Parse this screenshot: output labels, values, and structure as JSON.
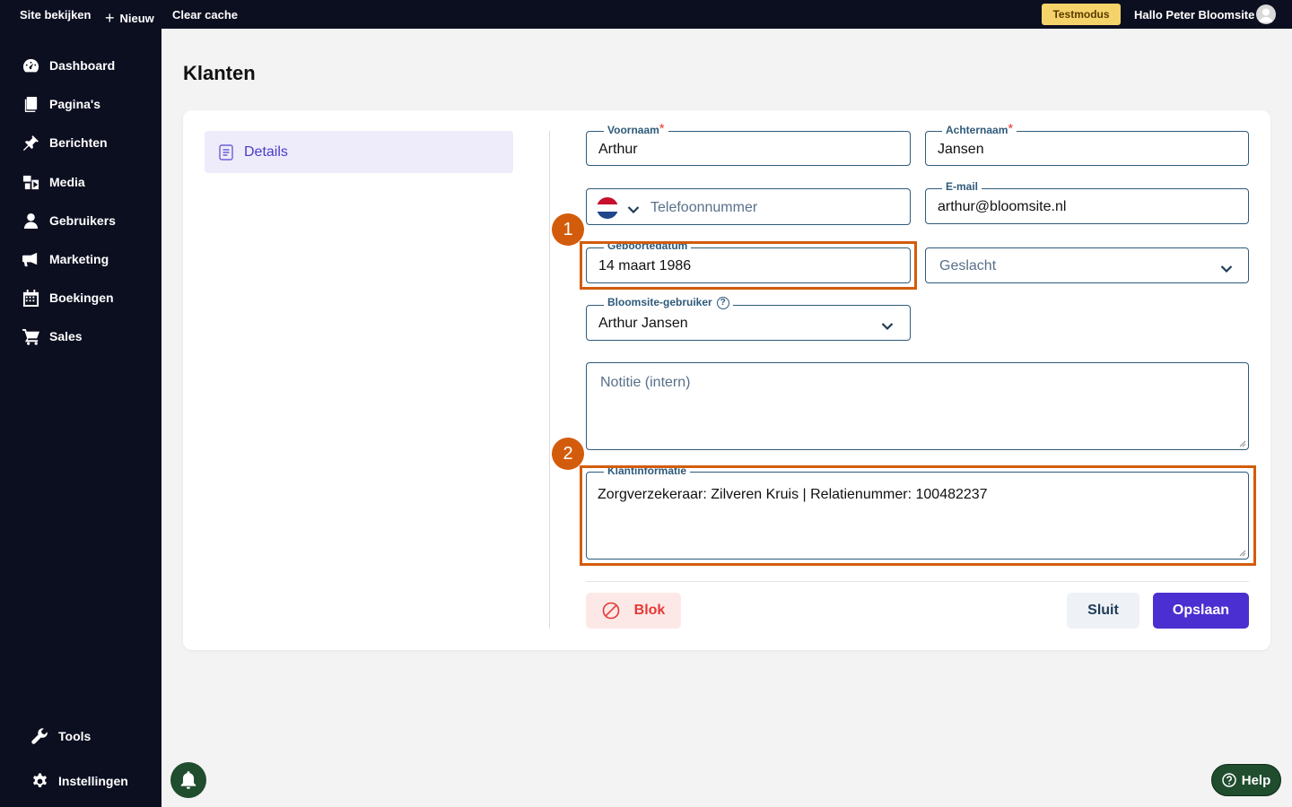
{
  "topbar": {
    "site_view": "Site bekijken",
    "new": "Nieuw",
    "clear_cache": "Clear cache",
    "test_mode": "Testmodus",
    "greeting": "Hallo Peter Bloomsite"
  },
  "sidebar": {
    "items": [
      {
        "label": "Dashboard",
        "icon": "dashboard-icon"
      },
      {
        "label": "Pagina's",
        "icon": "pages-icon"
      },
      {
        "label": "Berichten",
        "icon": "pin-icon"
      },
      {
        "label": "Media",
        "icon": "media-icon"
      },
      {
        "label": "Gebruikers",
        "icon": "user-icon"
      },
      {
        "label": "Marketing",
        "icon": "megaphone-icon"
      },
      {
        "label": "Boekingen",
        "icon": "calendar-icon"
      },
      {
        "label": "Sales",
        "icon": "cart-icon"
      }
    ],
    "tools": "Tools",
    "settings": "Instellingen"
  },
  "page": {
    "title": "Klanten",
    "tab_details": "Details"
  },
  "form": {
    "first_name_label": "Voornaam",
    "first_name_value": "Arthur",
    "last_name_label": "Achternaam",
    "last_name_value": "Jansen",
    "phone_placeholder": "Telefoonnummer",
    "phone_country": "NL",
    "email_label": "E-mail",
    "email_value": "arthur@bloomsite.nl",
    "birthdate_label": "Geboortedatum",
    "birthdate_value": "14 maart 1986",
    "gender_placeholder": "Geslacht",
    "bloomsite_user_label": "Bloomsite-gebruiker",
    "bloomsite_user_value": "Arthur Jansen",
    "note_placeholder": "Notitie (intern)",
    "customer_info_label": "Klantinformatie",
    "customer_info_value": "Zorgverzekeraar: Zilveren Kruis | Relatienummer: 100482237",
    "required_mark": "*"
  },
  "annotations": {
    "badge_1": "1",
    "badge_2": "2",
    "color": "#d35c0c"
  },
  "buttons": {
    "block": "Blok",
    "close": "Sluit",
    "save": "Opslaan",
    "help": "Help"
  },
  "colors": {
    "sidebar_bg": "#0c0f20",
    "accent": "#4b2fd0",
    "field_border": "#2e5a7a",
    "danger": "#e53935"
  }
}
